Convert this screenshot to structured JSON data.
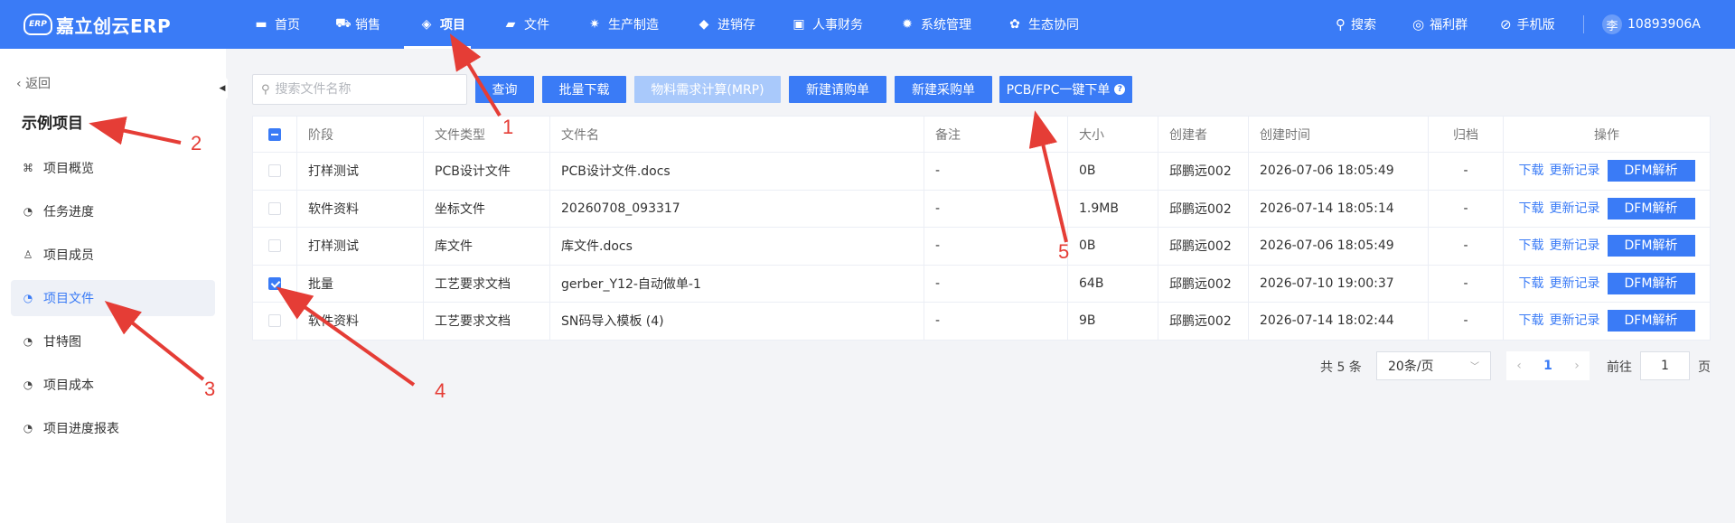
{
  "app": {
    "logo_badge": "ERP",
    "logo_text": "嘉立创云ERP"
  },
  "nav": [
    {
      "label": "首页",
      "icon": "monitor-icon"
    },
    {
      "label": "销售",
      "icon": "cart-icon"
    },
    {
      "label": "项目",
      "icon": "layers-icon",
      "active": true
    },
    {
      "label": "文件",
      "icon": "folder-icon"
    },
    {
      "label": "生产制造",
      "icon": "gear-icon"
    },
    {
      "label": "进销存",
      "icon": "box-icon"
    },
    {
      "label": "人事财务",
      "icon": "finance-icon"
    },
    {
      "label": "系统管理",
      "icon": "settings-icon"
    },
    {
      "label": "生态协同",
      "icon": "ecosystem-icon"
    }
  ],
  "tools": {
    "search": "搜索",
    "welfare": "福利群",
    "mobile": "手机版",
    "avatar_char": "李",
    "user": "10893906A"
  },
  "sidebar": {
    "back": "返回",
    "project_title": "示例项目",
    "items": [
      {
        "label": "项目概览",
        "icon": "command-icon"
      },
      {
        "label": "任务进度",
        "icon": "clock-icon"
      },
      {
        "label": "项目成员",
        "icon": "user-icon"
      },
      {
        "label": "项目文件",
        "icon": "clock-icon",
        "active": true
      },
      {
        "label": "甘特图",
        "icon": "clock-icon"
      },
      {
        "label": "项目成本",
        "icon": "clock-icon"
      },
      {
        "label": "项目进度报表",
        "icon": "clock-icon"
      }
    ]
  },
  "toolbar": {
    "search_placeholder": "搜索文件名称",
    "query": "查询",
    "batch_download": "批量下载",
    "mrp": "物料需求计算(MRP)",
    "new_request": "新建请购单",
    "new_purchase": "新建采购单",
    "pcb_order": "PCB/FPC一键下单"
  },
  "table": {
    "headers": [
      "阶段",
      "文件类型",
      "文件名",
      "备注",
      "大小",
      "创建者",
      "创建时间",
      "归档",
      "操作"
    ],
    "rows": [
      {
        "checked": false,
        "stage": "打样测试",
        "type": "PCB设计文件",
        "name": "PCB设计文件.docs",
        "note": "-",
        "size": "0B",
        "creator": "邱鹏远002",
        "time": "2026-07-06 18:05:49",
        "archive": "-"
      },
      {
        "checked": false,
        "stage": "软件资料",
        "type": "坐标文件",
        "name": "20260708_093317",
        "note": "-",
        "size": "1.9MB",
        "creator": "邱鹏远002",
        "time": "2026-07-14 18:05:14",
        "archive": "-"
      },
      {
        "checked": false,
        "stage": "打样测试",
        "type": "库文件",
        "name": "库文件.docs",
        "note": "-",
        "size": "0B",
        "creator": "邱鹏远002",
        "time": "2026-07-06 18:05:49",
        "archive": "-"
      },
      {
        "checked": true,
        "stage": "批量",
        "type": "工艺要求文档",
        "name": "gerber_Y12-自动做单-1",
        "note": "-",
        "size": "64B",
        "creator": "邱鹏远002",
        "time": "2026-07-10 19:00:37",
        "archive": "-"
      },
      {
        "checked": false,
        "stage": "软件资料",
        "type": "工艺要求文档",
        "name": "SN码导入模板 (4)",
        "note": "-",
        "size": "9B",
        "creator": "邱鹏远002",
        "time": "2026-07-14 18:02:44",
        "archive": "-"
      }
    ],
    "action_download": "下载",
    "action_history": "更新记录",
    "action_dfm": "DFM解析"
  },
  "pagination": {
    "total": "共 5 条",
    "page_size": "20条/页",
    "current": "1",
    "goto_label": "前往",
    "goto_value": "1",
    "page_label": "页"
  },
  "annotations": [
    "1",
    "2",
    "3",
    "4",
    "5"
  ],
  "colors": {
    "primary": "#3a7bf6",
    "annotation": "#e53d36"
  }
}
